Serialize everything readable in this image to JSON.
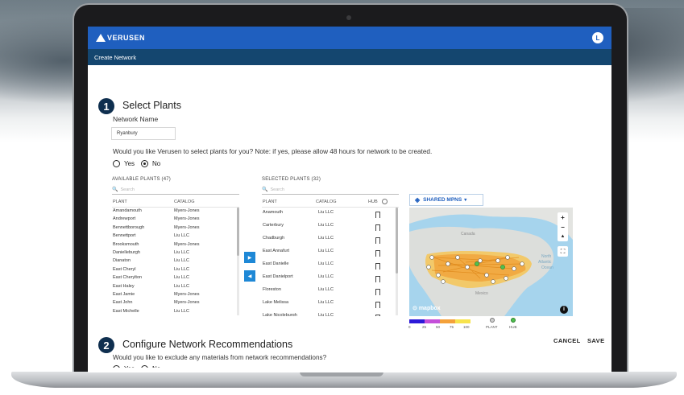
{
  "app": {
    "logo_text": "VERUSEN",
    "user_initial": "L",
    "page_title": "Create Network"
  },
  "step1": {
    "number": "1",
    "title": "Select Plants",
    "network_name_label": "Network Name",
    "network_name_value": "Ryanbury",
    "question": "Would you like Verusen to select plants for you? Note: if yes, please allow 48 hours for network to be created.",
    "options": [
      {
        "label": "Yes",
        "selected": false
      },
      {
        "label": "No",
        "selected": true
      }
    ]
  },
  "available": {
    "heading": "AVAILABLE PLANTS (47)",
    "search_placeholder": "Search",
    "col_plant": "PLANT",
    "col_catalog": "CATALOG",
    "rows": [
      [
        "Amandamouth",
        "Myers-Jones"
      ],
      [
        "Andrewport",
        "Myers-Jones"
      ],
      [
        "Bennettborough",
        "Myers-Jones"
      ],
      [
        "Bennettport",
        "Liu LLC"
      ],
      [
        "Brooksmouth",
        "Myers-Jones"
      ],
      [
        "Danielleburgh",
        "Liu LLC"
      ],
      [
        "Dianaton",
        "Liu LLC"
      ],
      [
        "East Cheryl",
        "Liu LLC"
      ],
      [
        "East Cherylton",
        "Liu LLC"
      ],
      [
        "East Haley",
        "Liu LLC"
      ],
      [
        "East Jamie",
        "Myers-Jones"
      ],
      [
        "East John",
        "Myers-Jones"
      ],
      [
        "East Michelle",
        "Liu LLC"
      ]
    ]
  },
  "selected": {
    "heading": "SELECTED PLANTS (32)",
    "search_placeholder": "Search",
    "col_plant": "PLANT",
    "col_catalog": "CATALOG",
    "col_hub": "HUB",
    "rows": [
      [
        "Anamouth",
        "Liu LLC"
      ],
      [
        "Carterbury",
        "Liu LLC"
      ],
      [
        "Chadburgh",
        "Liu LLC"
      ],
      [
        "East Annafurt",
        "Liu LLC"
      ],
      [
        "East Danielle",
        "Liu LLC"
      ],
      [
        "East Danielport",
        "Liu LLC"
      ],
      [
        "Floreston",
        "Liu LLC"
      ],
      [
        "Lake Melissa",
        "Liu LLC"
      ],
      [
        "Lake Nicoleburgh",
        "Liu LLC"
      ]
    ]
  },
  "map": {
    "shared_button": "SHARED MPNS",
    "zoom_in": "+",
    "zoom_out": "−",
    "compass": "▲",
    "fullscreen": "⛶",
    "attribution": "mapbox",
    "info": "i",
    "labels": {
      "canada": "Canada",
      "ocean": "North Atlantic Ocean",
      "mexico": "Mexico"
    },
    "legend_colors": [
      "#2d1ad8",
      "#c44fd9",
      "#f4a13a",
      "#f7e34c"
    ],
    "legend_ticks": [
      "0",
      "25",
      "50",
      "75",
      "100"
    ],
    "legend_plant": "PLANT",
    "legend_hub": "HUB"
  },
  "step2": {
    "number": "2",
    "title": "Configure Network Recommendations",
    "question": "Would you like to exclude any materials from network recommendations?",
    "options": [
      {
        "label": "Yes",
        "selected": true
      },
      {
        "label": "No",
        "selected": false
      }
    ]
  },
  "actions": {
    "cancel": "CANCEL",
    "save": "SAVE"
  }
}
